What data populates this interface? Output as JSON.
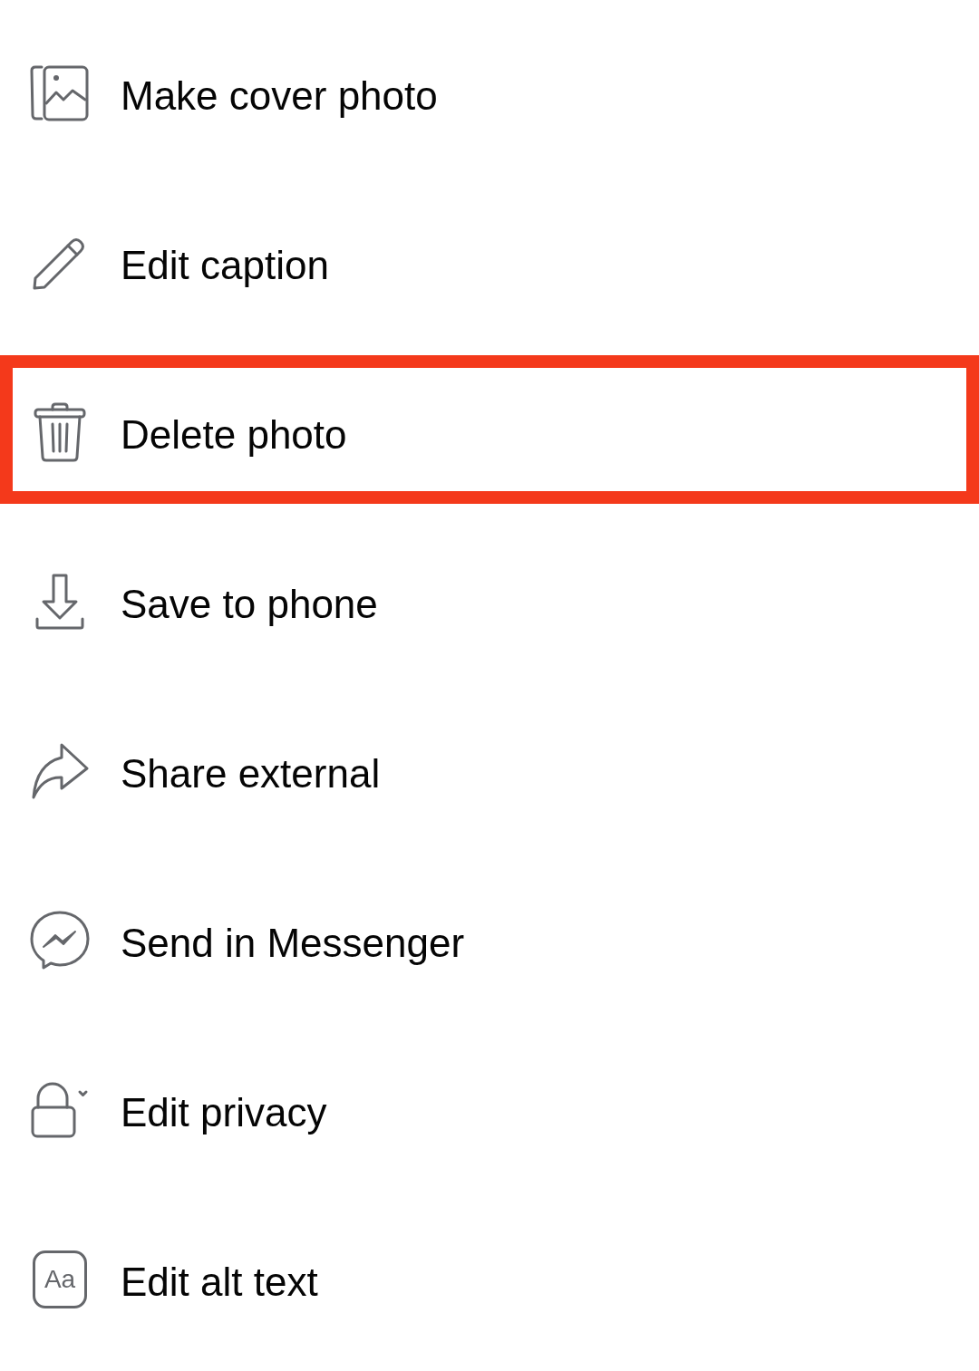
{
  "menu": {
    "items": [
      {
        "label": "Make cover photo",
        "highlighted": false
      },
      {
        "label": "Edit caption",
        "highlighted": false
      },
      {
        "label": "Delete photo",
        "highlighted": true
      },
      {
        "label": "Save to phone",
        "highlighted": false
      },
      {
        "label": "Share external",
        "highlighted": false
      },
      {
        "label": "Send in Messenger",
        "highlighted": false
      },
      {
        "label": "Edit privacy",
        "highlighted": false
      },
      {
        "label": "Edit alt text",
        "highlighted": false,
        "icon_text": "Aa"
      }
    ]
  }
}
